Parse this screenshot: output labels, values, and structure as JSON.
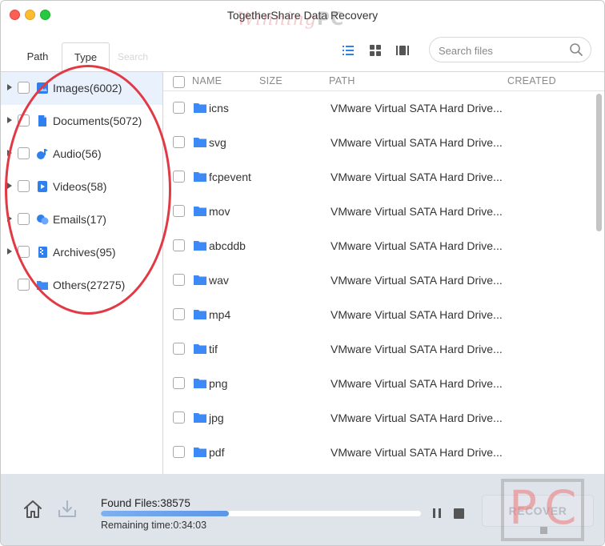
{
  "window": {
    "title": "TogetherShare Data Recovery"
  },
  "watermark": {
    "top_script": "Winning",
    "top_letters": "PC",
    "box_p": "P",
    "box_c": "C"
  },
  "tabs": {
    "path": "Path",
    "type": "Type",
    "search": "Search"
  },
  "view_modes": [
    "list-view-icon",
    "grid-view-icon",
    "preview-view-icon"
  ],
  "search": {
    "placeholder": "Search files"
  },
  "categories": [
    {
      "label": "Images(6002)",
      "icon": "image-icon",
      "expandable": true,
      "selected": true
    },
    {
      "label": "Documents(5072)",
      "icon": "document-icon",
      "expandable": true,
      "selected": false
    },
    {
      "label": "Audio(56)",
      "icon": "audio-icon",
      "expandable": true,
      "selected": false
    },
    {
      "label": "Videos(58)",
      "icon": "video-icon",
      "expandable": true,
      "selected": false
    },
    {
      "label": "Emails(17)",
      "icon": "email-icon",
      "expandable": true,
      "selected": false
    },
    {
      "label": "Archives(95)",
      "icon": "archive-icon",
      "expandable": true,
      "selected": false
    },
    {
      "label": "Others(27275)",
      "icon": "folder-icon",
      "expandable": false,
      "selected": false
    }
  ],
  "table": {
    "columns": {
      "name": "NAME",
      "size": "SIZE",
      "path": "PATH",
      "created": "CREATED"
    },
    "rows": [
      {
        "name": "icns",
        "path": "VMware Virtual SATA Hard Drive..."
      },
      {
        "name": "svg",
        "path": "VMware Virtual SATA Hard Drive..."
      },
      {
        "name": "fcpevent",
        "path": "VMware Virtual SATA Hard Drive..."
      },
      {
        "name": "mov",
        "path": "VMware Virtual SATA Hard Drive..."
      },
      {
        "name": "abcddb",
        "path": "VMware Virtual SATA Hard Drive..."
      },
      {
        "name": "wav",
        "path": "VMware Virtual SATA Hard Drive..."
      },
      {
        "name": "mp4",
        "path": "VMware Virtual SATA Hard Drive..."
      },
      {
        "name": "tif",
        "path": "VMware Virtual SATA Hard Drive..."
      },
      {
        "name": "png",
        "path": "VMware Virtual SATA Hard Drive..."
      },
      {
        "name": "jpg",
        "path": "VMware Virtual SATA Hard Drive..."
      },
      {
        "name": "pdf",
        "path": "VMware Virtual SATA Hard Drive..."
      }
    ]
  },
  "status": {
    "found": "Found Files:38575",
    "remaining": "Remaining time:0:34:03",
    "progress_fraction": 0.4
  },
  "actions": {
    "recover": "RECOVER"
  },
  "colors": {
    "accent": "#2f80ed",
    "folder": "#3d8af7",
    "selected_row": "#e9f1fd",
    "annotation": "#e23a44",
    "bottom_bar": "#dfe3ea"
  }
}
